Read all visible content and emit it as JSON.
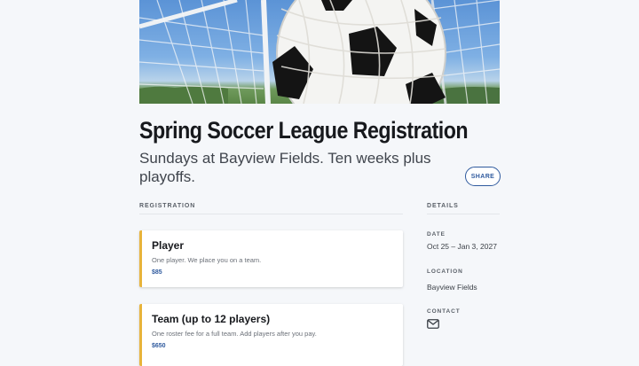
{
  "event": {
    "title": "Spring Soccer League Registration",
    "subtitle": "Sundays at Bayview Fields. Ten weeks plus playoffs.",
    "share_label": "SHARE"
  },
  "registration": {
    "heading": "REGISTRATION",
    "options": [
      {
        "title": "Player",
        "description": "One player. We place you on a team.",
        "price": "$85"
      },
      {
        "title": "Team (up to 12 players)",
        "description": "One roster fee for a full team. Add players after you pay.",
        "price": "$650"
      }
    ]
  },
  "details": {
    "heading": "DETAILS",
    "date_label": "DATE",
    "date_value": "Oct 25 – Jan 3, 2027",
    "location_label": "LOCATION",
    "location_value": "Bayview Fields",
    "contact_label": "CONTACT",
    "contact_icon": "mail-icon"
  },
  "colors": {
    "accent": "#2f5a9e",
    "card_border": "#e8b33a",
    "background": "#f5f7fa"
  }
}
